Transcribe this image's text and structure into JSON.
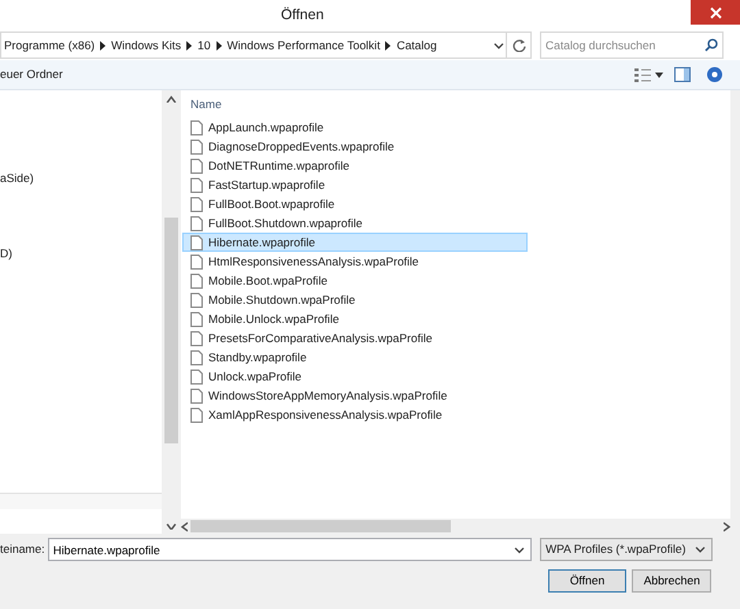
{
  "window": {
    "title": "Öffnen"
  },
  "address_bar": {
    "segments": [
      "Programme (x86)",
      "Windows Kits",
      "10",
      "Windows Performance Toolkit",
      "Catalog"
    ]
  },
  "search": {
    "placeholder": "Catalog durchsuchen"
  },
  "toolbar": {
    "new_folder": "euer Ordner"
  },
  "nav_pane": {
    "items": [
      "aSide)",
      "D)"
    ]
  },
  "file_list": {
    "column": "Name",
    "files": [
      {
        "name": "AppLaunch.wpaprofile",
        "selected": false
      },
      {
        "name": "DiagnoseDroppedEvents.wpaprofile",
        "selected": false
      },
      {
        "name": "DotNETRuntime.wpaprofile",
        "selected": false
      },
      {
        "name": "FastStartup.wpaprofile",
        "selected": false
      },
      {
        "name": "FullBoot.Boot.wpaprofile",
        "selected": false
      },
      {
        "name": "FullBoot.Shutdown.wpaprofile",
        "selected": false
      },
      {
        "name": "Hibernate.wpaprofile",
        "selected": true
      },
      {
        "name": "HtmlResponsivenessAnalysis.wpaProfile",
        "selected": false
      },
      {
        "name": "Mobile.Boot.wpaProfile",
        "selected": false
      },
      {
        "name": "Mobile.Shutdown.wpaProfile",
        "selected": false
      },
      {
        "name": "Mobile.Unlock.wpaProfile",
        "selected": false
      },
      {
        "name": "PresetsForComparativeAnalysis.wpaProfile",
        "selected": false
      },
      {
        "name": "Standby.wpaprofile",
        "selected": false
      },
      {
        "name": "Unlock.wpaProfile",
        "selected": false
      },
      {
        "name": "WindowsStoreAppMemoryAnalysis.wpaProfile",
        "selected": false
      },
      {
        "name": "XamlAppResponsivenessAnalysis.wpaProfile",
        "selected": false
      }
    ]
  },
  "filename": {
    "label": "teiname:",
    "value": "Hibernate.wpaprofile"
  },
  "filter": {
    "value": "WPA Profiles (*.wpaProfile)"
  },
  "buttons": [
    "Öffnen",
    "Abbrechen"
  ]
}
